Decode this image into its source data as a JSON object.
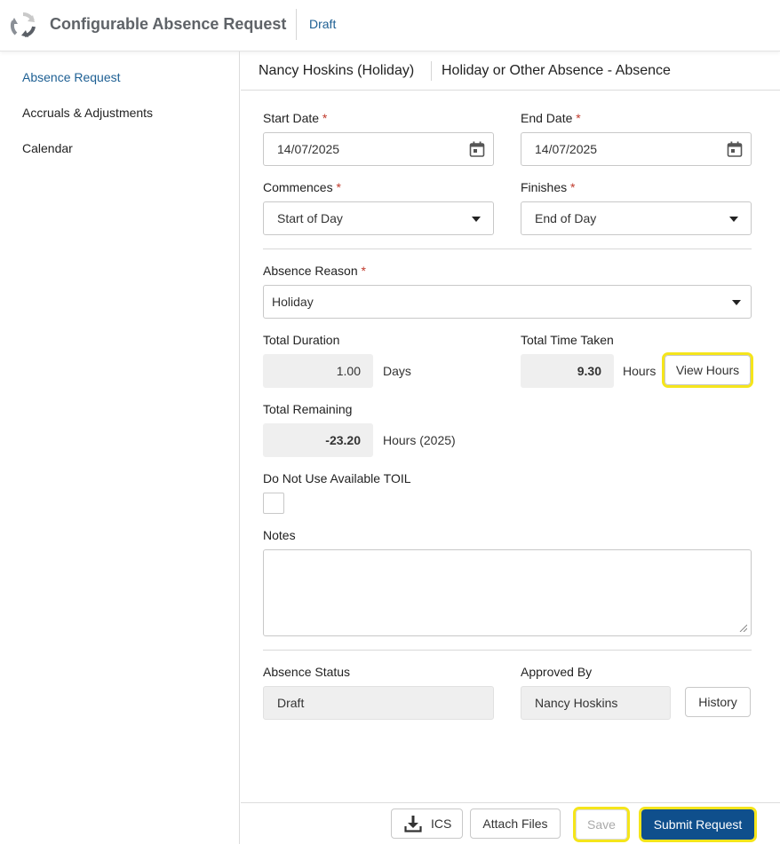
{
  "header": {
    "app_title": "Configurable Absence Request",
    "status": "Draft",
    "logo_icon": "refresh-cycle-icon"
  },
  "sidebar": {
    "items": [
      {
        "label": "Absence Request",
        "active": true
      },
      {
        "label": "Accruals & Adjustments",
        "active": false
      },
      {
        "label": "Calendar",
        "active": false
      }
    ]
  },
  "content_header": {
    "person": "Nancy Hoskins (Holiday)",
    "absence_type": "Holiday or Other Absence - Absence"
  },
  "form": {
    "start_date": {
      "label": "Start Date",
      "required": "*",
      "value": "14/07/2025",
      "icon": "calendar-icon"
    },
    "end_date": {
      "label": "End Date",
      "required": "*",
      "value": "14/07/2025",
      "icon": "calendar-icon"
    },
    "commences": {
      "label": "Commences",
      "required": "*",
      "value": "Start of Day"
    },
    "finishes": {
      "label": "Finishes",
      "required": "*",
      "value": "End of Day"
    },
    "absence_reason": {
      "label": "Absence Reason",
      "required": "*",
      "value": "Holiday"
    },
    "total_duration": {
      "label": "Total Duration",
      "value": "1.00",
      "unit": "Days"
    },
    "total_time_taken": {
      "label": "Total Time Taken",
      "value": "9.30",
      "unit": "Hours",
      "button": "View Hours"
    },
    "total_remaining": {
      "label": "Total Remaining",
      "value": "-23.20",
      "unit": "Hours (2025)"
    },
    "toil": {
      "label": "Do Not Use Available TOIL",
      "checked": false
    },
    "notes": {
      "label": "Notes",
      "value": ""
    },
    "absence_status": {
      "label": "Absence Status",
      "value": "Draft"
    },
    "approved_by": {
      "label": "Approved By",
      "value": "Nancy Hoskins",
      "button": "History"
    }
  },
  "footer": {
    "ics_label": "ICS",
    "ics_icon": "download-icon",
    "attach_label": "Attach Files",
    "save_label": "Save",
    "submit_label": "Submit Request"
  },
  "colors": {
    "accent": "#1d5f93",
    "submit": "#0f4f8c",
    "highlight": "#f5e51b",
    "required": "#c0392b"
  }
}
